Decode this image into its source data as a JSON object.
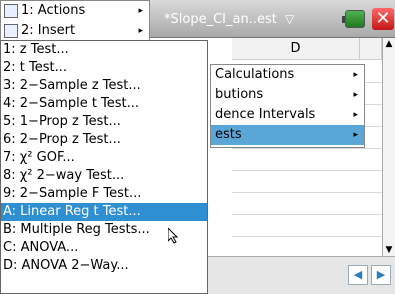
{
  "window": {
    "doc_tab_label": "*Slope_CI_an..est",
    "doc_tab_arrow": "▽",
    "close_label": "✕"
  },
  "root_menu": {
    "items": [
      {
        "label": "1: Actions"
      },
      {
        "label": "2: Insert"
      }
    ]
  },
  "sheet": {
    "col_d": "D",
    "col_e": "",
    "scroll_up": "▲",
    "scroll_down": "▼",
    "nav_left": "◀",
    "nav_right": "▶"
  },
  "stats_submenu": {
    "items": [
      {
        "label": "Calculations"
      },
      {
        "label": "butions"
      },
      {
        "label": "dence Intervals"
      },
      {
        "label": "ests"
      }
    ]
  },
  "tests_submenu": {
    "items": [
      {
        "label": "1: z Test..."
      },
      {
        "label": "2: t Test..."
      },
      {
        "label": "3: 2−Sample z Test..."
      },
      {
        "label": "4: 2−Sample t Test..."
      },
      {
        "label": "5: 1−Prop z Test..."
      },
      {
        "label": "6: 2−Prop z Test..."
      },
      {
        "label": "7: χ² GOF..."
      },
      {
        "label": "8: χ² 2−way Test..."
      },
      {
        "label": "9: 2−Sample F Test..."
      },
      {
        "label": "A: Linear Reg t Test..."
      },
      {
        "label": "B: Multiple Reg Tests..."
      },
      {
        "label": "C: ANOVA..."
      },
      {
        "label": "D: ANOVA 2−Way..."
      }
    ],
    "selected_index": 9
  },
  "colors": {
    "selected_item": "#2f8fd1",
    "submenu_active": "#59a6d7"
  }
}
